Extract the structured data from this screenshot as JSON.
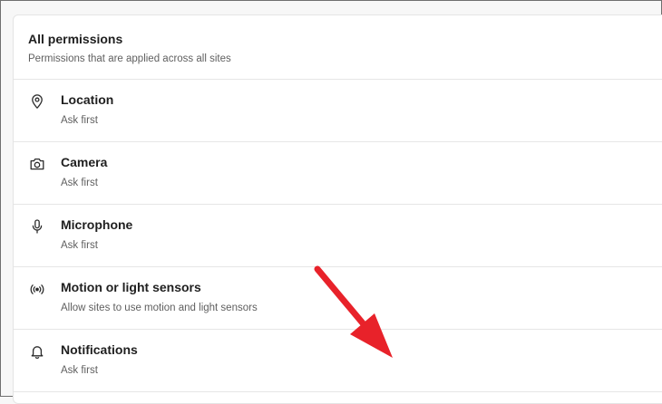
{
  "header": {
    "title": "All permissions",
    "subtitle": "Permissions that are applied across all sites"
  },
  "permissions": [
    {
      "icon": "location-pin-icon",
      "label": "Location",
      "desc": "Ask first"
    },
    {
      "icon": "camera-icon",
      "label": "Camera",
      "desc": "Ask first"
    },
    {
      "icon": "microphone-icon",
      "label": "Microphone",
      "desc": "Ask first"
    },
    {
      "icon": "sensors-icon",
      "label": "Motion or light sensors",
      "desc": "Allow sites to use motion and light sensors"
    },
    {
      "icon": "bell-icon",
      "label": "Notifications",
      "desc": "Ask first"
    }
  ],
  "colors": {
    "arrow": "#e8222a",
    "text": "#1f1f1f",
    "subtext": "#5f5f5f",
    "divider": "#e6e6e6"
  }
}
